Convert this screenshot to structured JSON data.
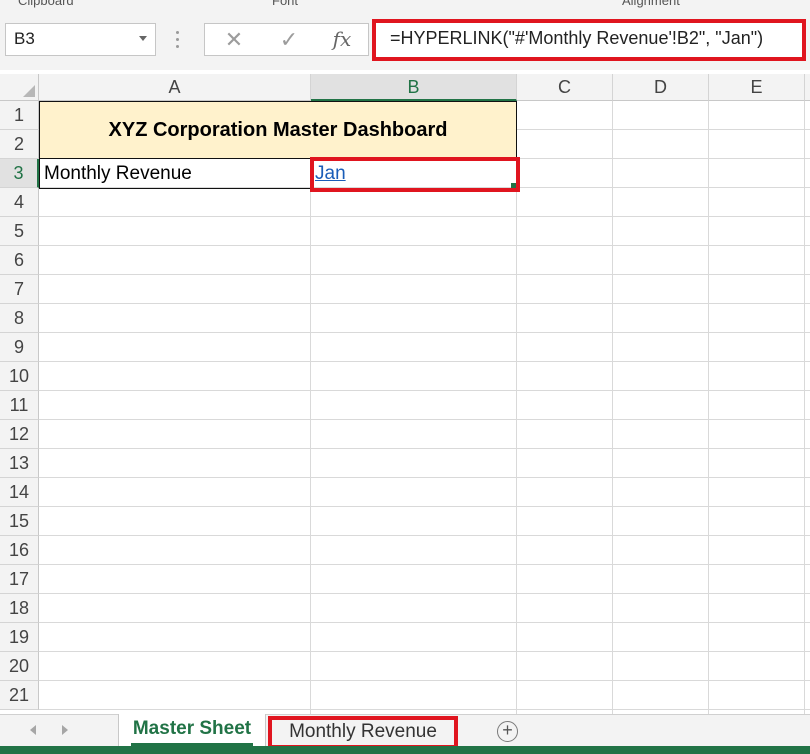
{
  "ribbon_groups": [
    "Clipboard",
    "Font",
    "Alignment"
  ],
  "formula_bar": {
    "name_box": "B3",
    "cancel_glyph": "✕",
    "enter_glyph": "✓",
    "fx_label": "fx",
    "formula": "=HYPERLINK(\"#'Monthly Revenue'!B2\", \"Jan\")"
  },
  "columns": [
    "A",
    "B",
    "C",
    "D",
    "E"
  ],
  "rows": [
    "1",
    "2",
    "3",
    "4",
    "5",
    "6",
    "7",
    "8",
    "9",
    "10",
    "11",
    "12",
    "13",
    "14",
    "15",
    "16",
    "17",
    "18",
    "19",
    "20",
    "21"
  ],
  "selected_cell": {
    "column": "B",
    "row": "3"
  },
  "cells": {
    "title": "XYZ Corporation Master Dashboard",
    "a3": "Monthly Revenue",
    "b3": "Jan"
  },
  "sheet_tabs": {
    "active": "Master Sheet",
    "other": "Monthly Revenue",
    "add_symbol": "+"
  },
  "colors": {
    "excel_green": "#217346",
    "highlight_red": "#e0151f",
    "title_fill": "#fff2cc",
    "hyperlink": "#1a5db8"
  },
  "icons": [
    "dropdown-caret-icon",
    "cancel-icon",
    "enter-icon",
    "function-icon",
    "select-all-icon",
    "scroll-left-icon",
    "scroll-right-icon",
    "add-sheet-icon"
  ]
}
